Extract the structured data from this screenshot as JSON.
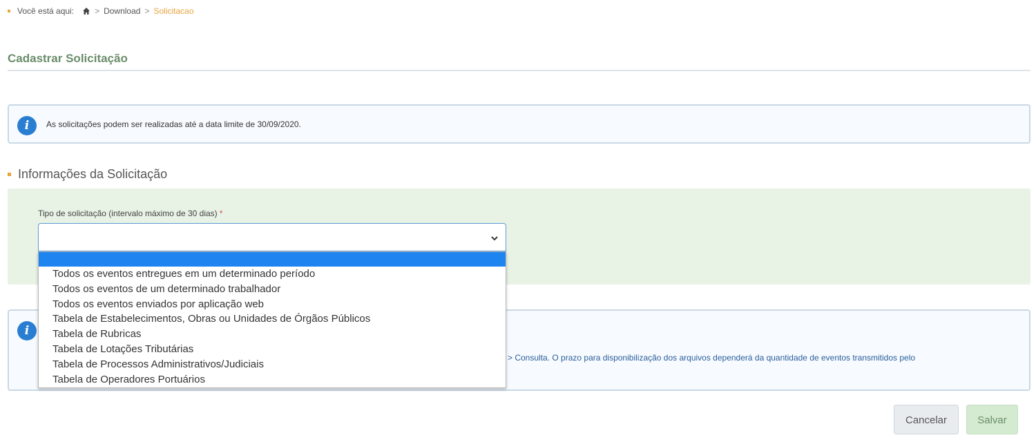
{
  "breadcrumb": {
    "prefix": "Você está aqui:",
    "home_icon": "home-icon",
    "separator": ">",
    "items": [
      "Download",
      "Solicitacao"
    ]
  },
  "page_title": "Cadastrar Solicitação",
  "notice_top": {
    "icon": "info-icon",
    "text": "As solicitações podem ser realizadas até a data limite de 30/09/2020."
  },
  "section": {
    "title": "Informações da Solicitação"
  },
  "form": {
    "field_label": "Tipo de solicitação (intervalo máximo de 30 dias)",
    "required_mark": "*",
    "select_value": "",
    "chevron_icon": "chevron-down-icon",
    "options": [
      "",
      "Todos os eventos entregues em um determinado período",
      "Todos os eventos de um determinado trabalhador",
      "Todos os eventos enviados por aplicação web",
      "Tabela de Estabelecimentos, Obras ou Unidades de Órgãos Públicos",
      "Tabela de Rubricas",
      "Tabela de Lotações Tributárias",
      "Tabela de Processos Administrativos/Judiciais",
      "Tabela de Operadores Portuários"
    ]
  },
  "notice_bottom": {
    "icon": "info-icon",
    "visible_text": "> Consulta. O prazo para disponibilização dos arquivos dependerá da quantidade de eventos transmitidos pelo"
  },
  "buttons": {
    "cancel": "Cancelar",
    "save": "Salvar"
  },
  "colors": {
    "accent_orange": "#e8a33c",
    "title_green": "#6a8d6a",
    "info_blue": "#2a7ed2",
    "highlight_blue": "#1e84f0",
    "panel_green": "#e8f2e5"
  }
}
